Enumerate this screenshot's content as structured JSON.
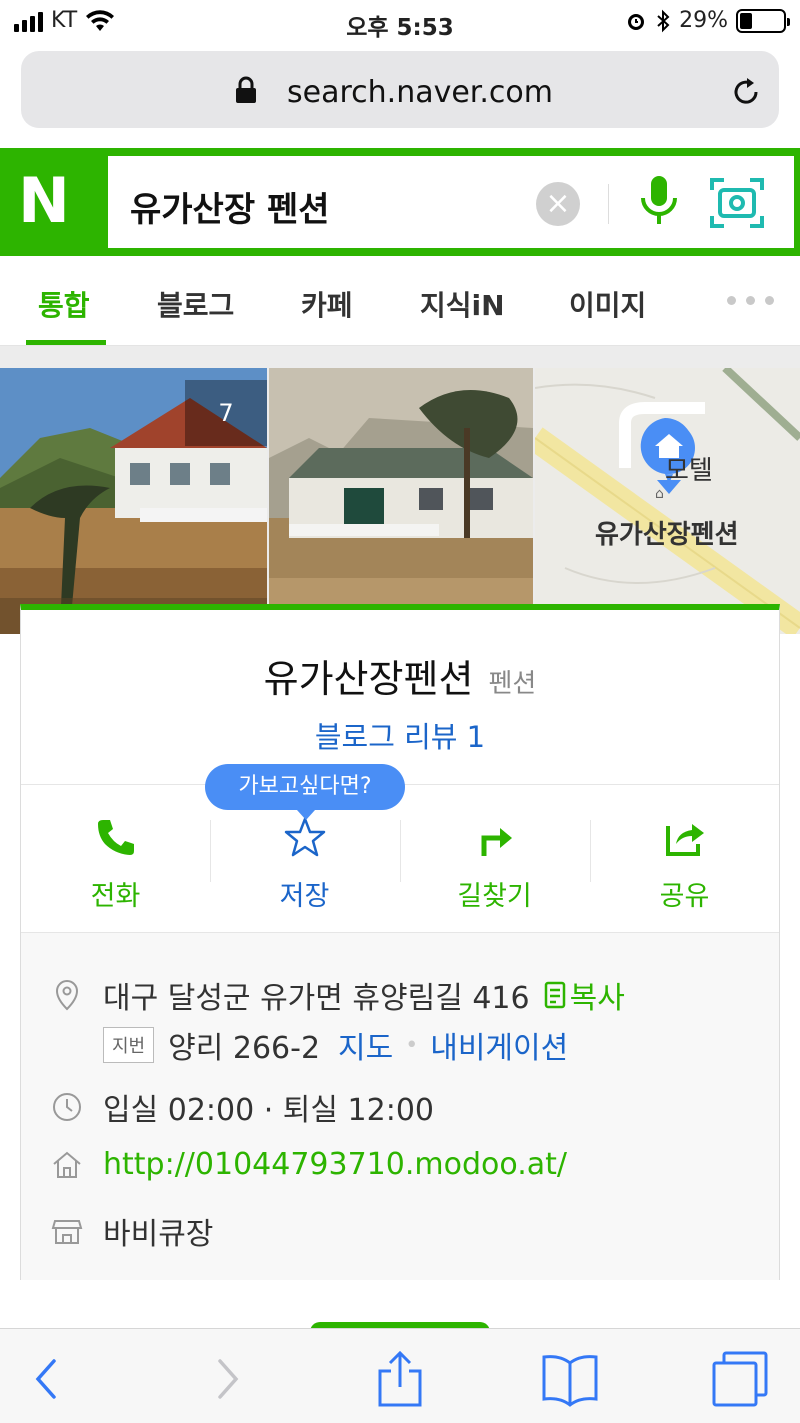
{
  "status_bar": {
    "carrier": "KT",
    "time": "오후 5:53",
    "battery": "29%",
    "battery_level": 0.29
  },
  "browser": {
    "url": "search.naver.com"
  },
  "search": {
    "logo": "N",
    "query": "유가산장 펜션"
  },
  "tabs": [
    {
      "label": "통합",
      "active": true
    },
    {
      "label": "블로그",
      "active": false
    },
    {
      "label": "카페",
      "active": false
    },
    {
      "label": "지식iN",
      "active": false
    },
    {
      "label": "이미지",
      "active": false
    }
  ],
  "gallery": {
    "photo_count": "7",
    "map_labels": {
      "motel": "모텔",
      "place": "유가산장펜션"
    }
  },
  "place": {
    "name": "유가산장펜션",
    "category": "펜션",
    "blog_review": "블로그 리뷰 1",
    "tooltip": "가보고싶다면?",
    "actions": [
      {
        "label": "전화",
        "icon": "phone-icon"
      },
      {
        "label": "저장",
        "icon": "star-icon"
      },
      {
        "label": "길찾기",
        "icon": "directions-icon"
      },
      {
        "label": "공유",
        "icon": "share-icon"
      }
    ],
    "address": "대구 달성군 유가면 휴양림길 416",
    "copy_label": "복사",
    "jibun_badge": "지번",
    "jibun_address": "양리 266-2",
    "map_link": "지도",
    "navigation_link": "내비게이션",
    "hours": "입실 02:00 · 퇴실 12:00",
    "homepage": "http://01044793710.modoo.at/",
    "amenity": "바비큐장"
  },
  "colors": {
    "naver_green": "#2db400",
    "link_blue": "#1b65c9",
    "tooltip_blue": "#4a8ef5",
    "ios_blue": "#3478f6"
  }
}
